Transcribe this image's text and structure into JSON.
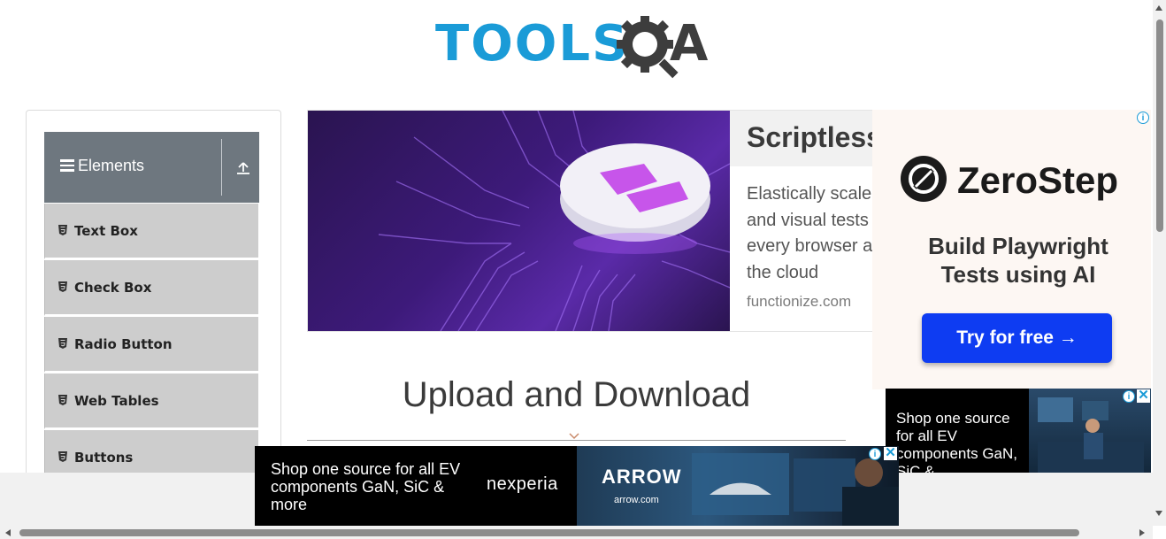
{
  "logo": {
    "text_main": "TOOLS",
    "text_end": "A"
  },
  "sidebar": {
    "group_title": "Elements",
    "items": [
      {
        "label": "Text Box"
      },
      {
        "label": "Check Box"
      },
      {
        "label": "Radio Button"
      },
      {
        "label": "Web Tables"
      },
      {
        "label": "Buttons"
      }
    ]
  },
  "top_ad": {
    "headline": "Scriptless",
    "body_lines": [
      "Elastically scale",
      "and visual tests",
      "every browser a",
      "the cloud"
    ],
    "domain": "functionize.com"
  },
  "right_ad": {
    "brand": "ZeroStep",
    "tagline_lines": [
      "Build Playwright",
      "Tests using AI"
    ],
    "cta": "Try for free →"
  },
  "main": {
    "page_title": "Upload and Download"
  },
  "small_ad": {
    "text": "Shop one source for all EV components GaN, SiC &"
  },
  "bottom_ad": {
    "text": "Shop one source for all EV components GaN, SiC & more",
    "brand": "nexperia",
    "partner": "ARROW",
    "partner_domain": "arrow.com"
  },
  "colors": {
    "logo_blue": "#1a9bd7",
    "sidebar_header": "#6e777f",
    "menu_item_bg": "#cdcdcd",
    "cta_blue": "#0e3cf2"
  }
}
